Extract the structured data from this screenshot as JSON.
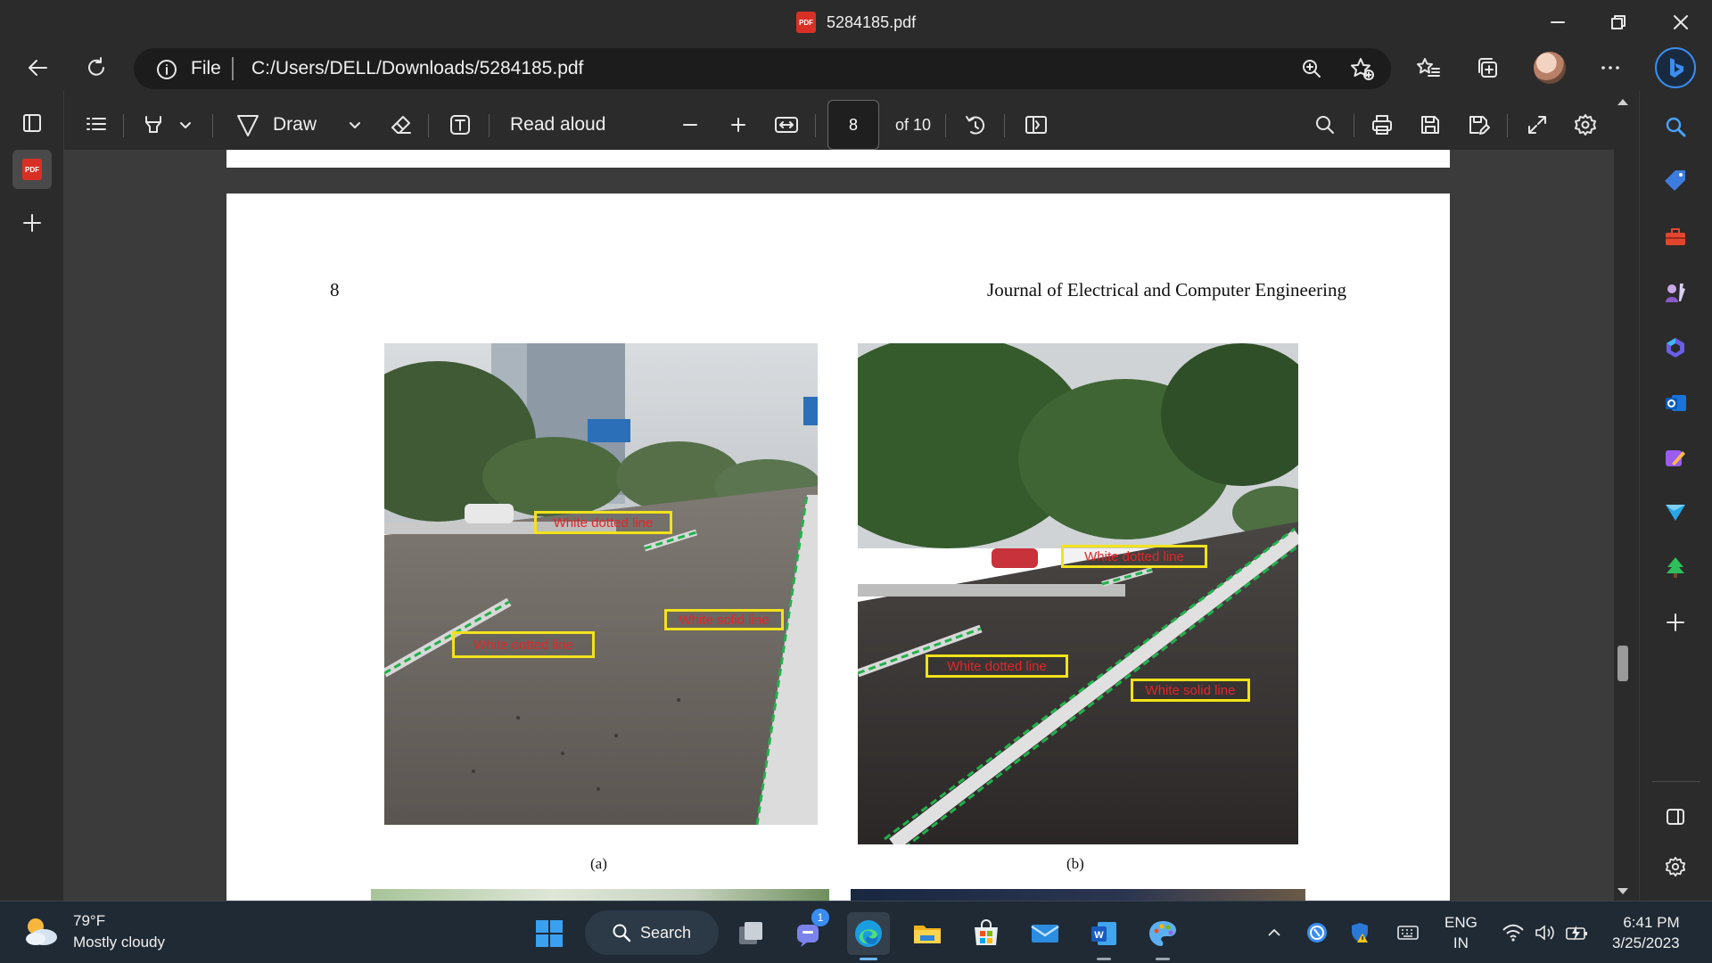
{
  "window": {
    "title": "5284185.pdf",
    "pdf_badge": "PDF"
  },
  "address": {
    "scheme_label": "File",
    "url": "C:/Users/DELL/Downloads/5284185.pdf"
  },
  "toolbar": {
    "draw_label": "Draw",
    "read_aloud_label": "Read aloud",
    "page_current": "8",
    "page_total": "of 10"
  },
  "document": {
    "page_number": "8",
    "journal_title": "Journal of Electrical and Computer Engineering",
    "figures": [
      {
        "caption": "(a)",
        "labels": [
          "White dotted line",
          "White dotted line",
          "White solid line"
        ]
      },
      {
        "caption": "(b)",
        "labels": [
          "White dotted line",
          "White dotted line",
          "White solid line"
        ]
      }
    ]
  },
  "taskbar": {
    "weather_temp": "79°F",
    "weather_desc": "Mostly cloudy",
    "search_label": "Search",
    "teams_badge": "1",
    "lang_line1": "ENG",
    "lang_line2": "IN",
    "time": "6:41 PM",
    "date": "3/25/2023"
  },
  "colors": {
    "accent": "#3a8df0",
    "label_border": "#f2e21b",
    "label_text": "#e3262b",
    "lane_marking": "#22b14c"
  }
}
